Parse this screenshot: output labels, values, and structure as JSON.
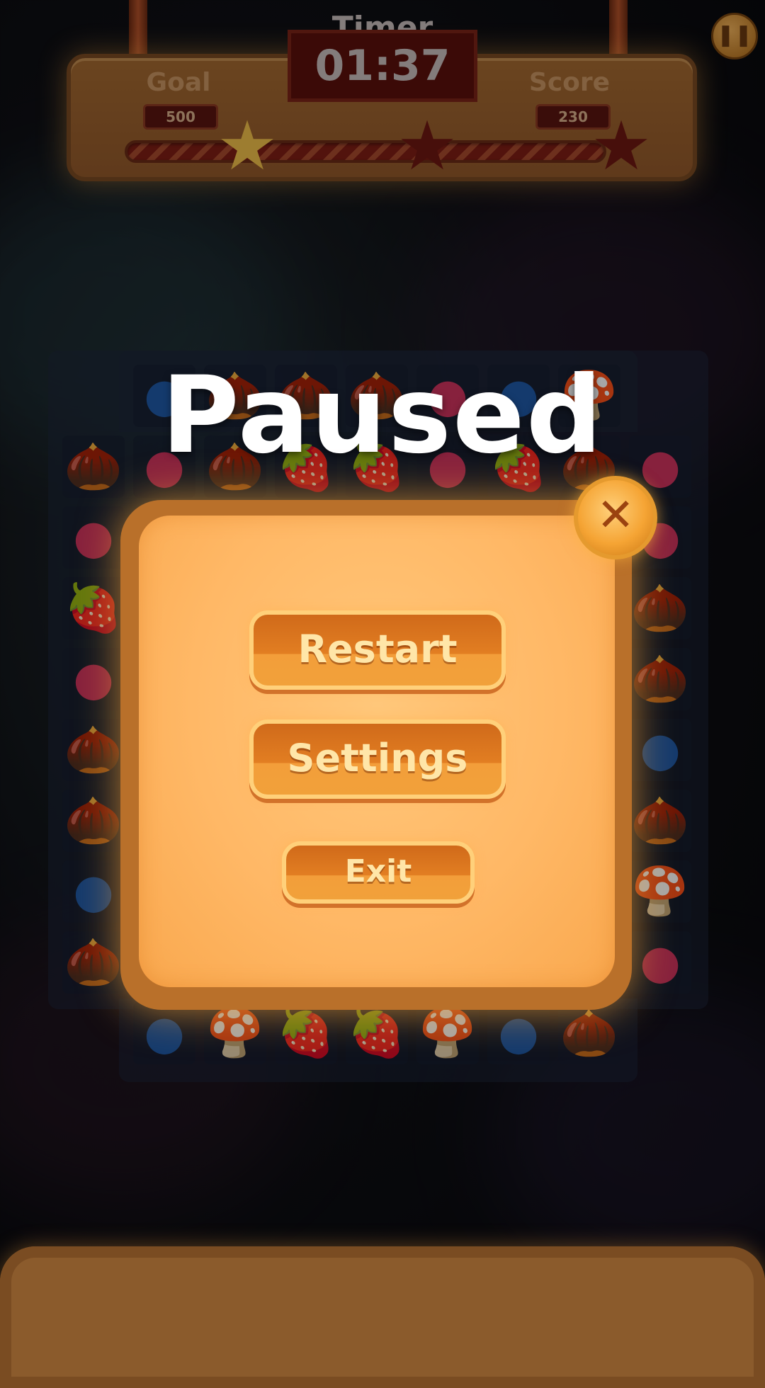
{
  "hud": {
    "timer_title": "Timer",
    "timer_value": "01:37",
    "goal_label": "Goal",
    "goal_value": "500",
    "score_label": "Score",
    "score_value": "230",
    "stars_earned": 1,
    "stars_total": 3
  },
  "pause_icon": "pause-icon",
  "paused_title": "Paused",
  "menu": {
    "restart_label": "Restart",
    "settings_label": "Settings",
    "exit_label": "Exit",
    "close_icon": "close-icon"
  },
  "board": {
    "rows": [
      [
        "",
        "blueberry",
        "acorn",
        "acorn",
        "acorn",
        "raspberry",
        "blueberry",
        "mushroom",
        ""
      ],
      [
        "acorn",
        "raspberry",
        "acorn",
        "strawberry",
        "strawberry",
        "raspberry",
        "strawberry",
        "acorn",
        "raspberry"
      ],
      [
        "raspberry",
        "",
        "",
        "",
        "",
        "",
        "",
        "",
        "raspberry"
      ],
      [
        "strawberry",
        "",
        "",
        "",
        "",
        "",
        "",
        "",
        "acorn"
      ],
      [
        "raspberry",
        "",
        "",
        "",
        "",
        "",
        "",
        "",
        "acorn"
      ],
      [
        "acorn",
        "",
        "",
        "",
        "",
        "",
        "",
        "",
        "blueberry"
      ],
      [
        "acorn",
        "",
        "",
        "",
        "",
        "",
        "",
        "",
        "acorn"
      ],
      [
        "blueberry",
        "",
        "",
        "",
        "",
        "",
        "",
        "",
        "mushroom"
      ],
      [
        "acorn",
        "",
        "",
        "",
        "",
        "",
        "",
        "",
        "raspberry"
      ],
      [
        "",
        "blueberry",
        "mushroom",
        "strawberry",
        "strawberry",
        "mushroom",
        "blueberry",
        "acorn",
        ""
      ]
    ]
  },
  "colors": {
    "modal_fill": "#ffb866",
    "modal_border": "#b9702a",
    "button_fill": "#e27e22",
    "button_text": "#ffe6a8",
    "title_text": "#ffffff"
  }
}
